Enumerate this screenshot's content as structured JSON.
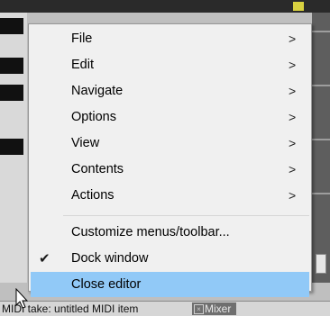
{
  "menu": {
    "items": [
      {
        "label": "File",
        "arrow": ">"
      },
      {
        "label": "Edit",
        "arrow": ">"
      },
      {
        "label": "Navigate",
        "arrow": ">"
      },
      {
        "label": "Options",
        "arrow": ">"
      },
      {
        "label": "View",
        "arrow": ">"
      },
      {
        "label": "Contents",
        "arrow": ">"
      },
      {
        "label": "Actions",
        "arrow": ">"
      },
      {
        "label": "Customize menus/toolbar..."
      },
      {
        "label": "Dock window",
        "check": "✔",
        "checked": true
      },
      {
        "label": "Close editor",
        "highlighted": true
      }
    ]
  },
  "statusbar": {
    "text": "MIDI take: untitled MIDI item",
    "mixer_label": "Mixer",
    "mixer_close": "×"
  },
  "colors": {
    "menu_bg": "#f0f0f0",
    "highlight": "#91c9f7",
    "separator": "#d7d7d7"
  },
  "icons": {
    "submenu": "chevron-right-icon",
    "check": "checkmark-icon",
    "pointer": "mouse-cursor-icon"
  }
}
